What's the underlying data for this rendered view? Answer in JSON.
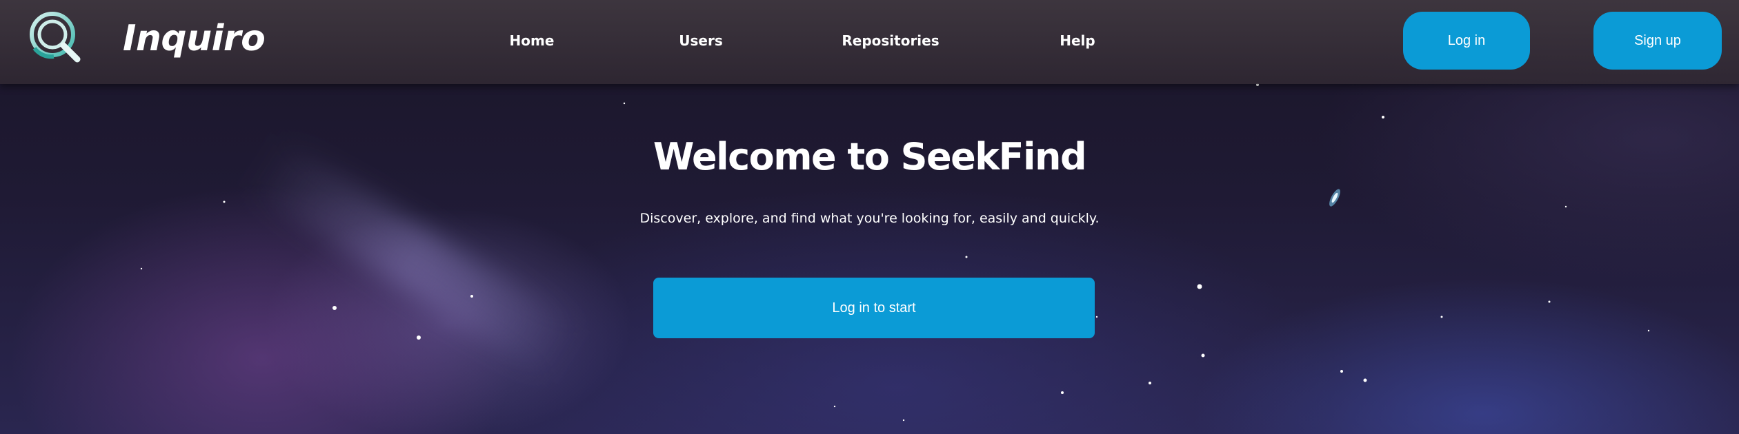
{
  "header": {
    "brand": "Inquiro",
    "logo_icon": "magnifier-q-logo-icon",
    "nav": [
      {
        "label": "Home"
      },
      {
        "label": "Users"
      },
      {
        "label": "Repositories"
      },
      {
        "label": "Help"
      }
    ],
    "login_label": "Log in",
    "signup_label": "Sign up"
  },
  "hero": {
    "title": "Welcome to SeekFind",
    "subtitle": "Discover, explore, and find what you're looking for, easily and quickly.",
    "cta_label": "Log in to start"
  },
  "colors": {
    "accent": "#0b9bd6",
    "header_bg": "#3a3240",
    "background": "#1f1a34",
    "text": "#ffffff"
  }
}
